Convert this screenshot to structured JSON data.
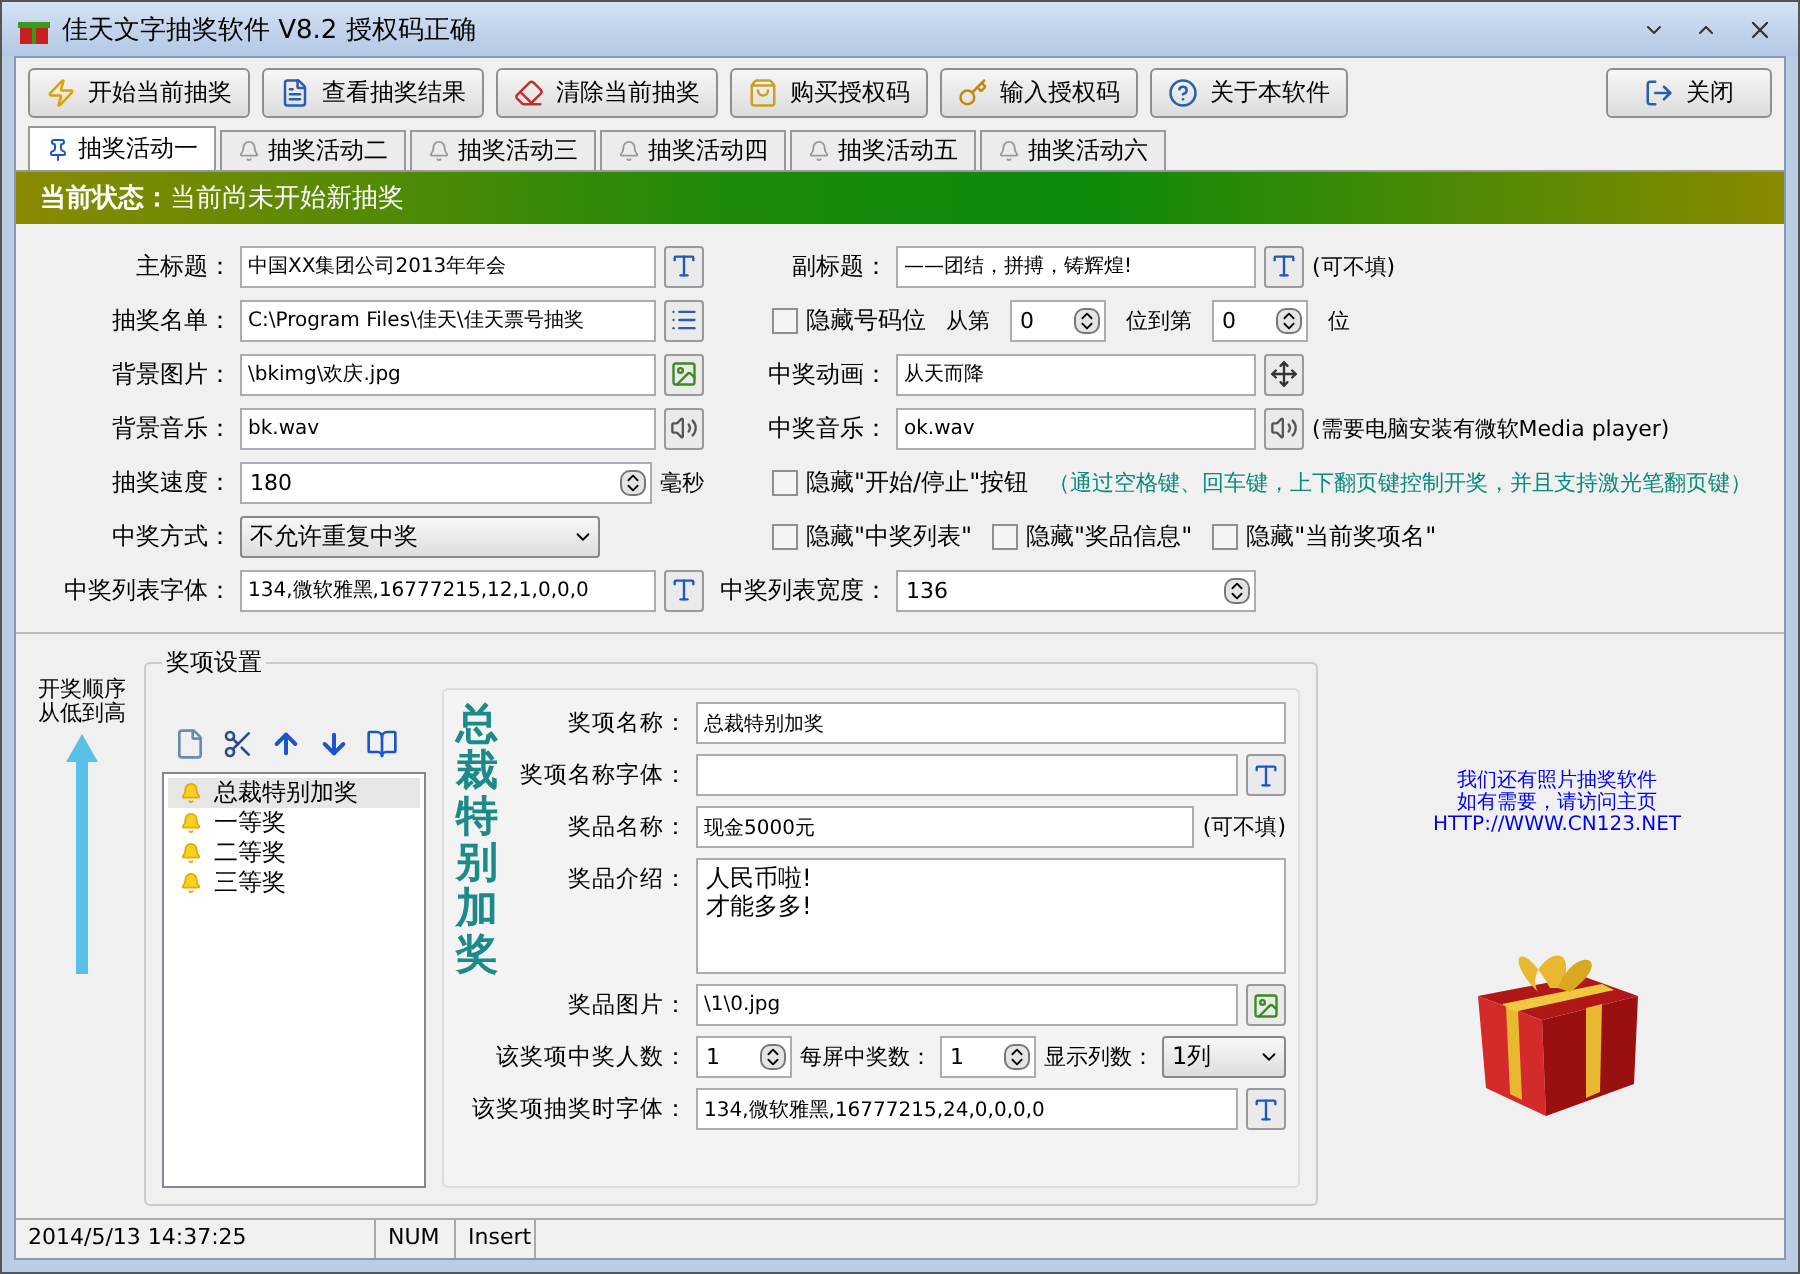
{
  "window": {
    "title": "佳天文字抽奖软件 V8.2 授权码正确"
  },
  "toolbar": {
    "left": [
      {
        "kind": "start",
        "label": "开始当前抽奖"
      },
      {
        "kind": "view",
        "label": "查看抽奖结果"
      },
      {
        "kind": "clear",
        "label": "清除当前抽奖"
      },
      {
        "kind": "buy",
        "label": "购买授权码"
      },
      {
        "kind": "enter",
        "label": "输入授权码"
      },
      {
        "kind": "about",
        "label": "关于本软件"
      }
    ],
    "right": [
      {
        "kind": "exit",
        "label": "关闭"
      }
    ]
  },
  "tabs": [
    {
      "label": "抽奖活动一",
      "selected": true
    },
    {
      "label": "抽奖活动二",
      "selected": false
    },
    {
      "label": "抽奖活动三",
      "selected": false
    },
    {
      "label": "抽奖活动四",
      "selected": false
    },
    {
      "label": "抽奖活动五",
      "selected": false
    },
    {
      "label": "抽奖活动六",
      "selected": false
    }
  ],
  "status_banner": {
    "label": "当前状态：",
    "value": "当前尚未开始新抽奖"
  },
  "settings": [
    {
      "left": {
        "label": "主标题：",
        "parts": [
          {
            "kind": "font-field",
            "value": "中国XX集团公司2013年年会"
          }
        ]
      },
      "right": {
        "label": "副标题：",
        "parts": [
          {
            "kind": "font-field",
            "value": "——团结，拼搏，铸辉煌!"
          },
          {
            "kind": "note",
            "text": "(可不填)"
          }
        ]
      }
    },
    {
      "left": {
        "label": "抽奖名单：",
        "parts": [
          {
            "kind": "list-field",
            "value": "C:\\Program Files\\佳天\\佳天票号抽奖"
          }
        ]
      },
      "right": {
        "parts": [
          {
            "kind": "check",
            "label": "隐藏号码位",
            "checked": false
          },
          {
            "kind": "note",
            "text": "从第"
          },
          {
            "kind": "spin-small",
            "value": "0"
          },
          {
            "kind": "note",
            "text": "位到第"
          },
          {
            "kind": "spin-small",
            "value": "0"
          },
          {
            "kind": "note",
            "text": "位"
          }
        ]
      }
    },
    {
      "left": {
        "label": "背景图片：",
        "parts": [
          {
            "kind": "image-field",
            "value": "\\bkimg\\欢庆.jpg"
          }
        ]
      },
      "right": {
        "label": "中奖动画：",
        "parts": [
          {
            "kind": "animation-field",
            "value": "从天而降"
          }
        ]
      }
    },
    {
      "left": {
        "label": "背景音乐：",
        "parts": [
          {
            "kind": "sound-field",
            "value": "bk.wav"
          }
        ]
      },
      "right": {
        "label": "中奖音乐：",
        "parts": [
          {
            "kind": "sound-field",
            "value": "ok.wav"
          },
          {
            "kind": "note",
            "text": "(需要电脑安装有微软Media player)"
          }
        ]
      }
    },
    {
      "left": {
        "label": "抽奖速度：",
        "parts": [
          {
            "kind": "spin",
            "value": "180"
          },
          {
            "kind": "note",
            "text": "毫秒"
          }
        ]
      },
      "right": {
        "parts": [
          {
            "kind": "check",
            "label": "隐藏\"开始/停止\"按钮",
            "checked": false
          },
          {
            "kind": "hint",
            "text": "（通过空格键、回车键，上下翻页键控制开奖，并且支持激光笔翻页键）"
          }
        ]
      }
    },
    {
      "left": {
        "label": "中奖方式：",
        "parts": [
          {
            "kind": "select",
            "value": "不允许重复中奖"
          }
        ]
      },
      "right": {
        "parts": [
          {
            "kind": "check",
            "label": "隐藏\"中奖列表\"",
            "checked": false
          },
          {
            "kind": "check",
            "label": "隐藏\"奖品信息\"",
            "checked": false
          },
          {
            "kind": "check",
            "label": "隐藏\"当前奖项名\"",
            "checked": false
          }
        ]
      }
    },
    {
      "left": {
        "label": "中奖列表字体：",
        "parts": [
          {
            "kind": "font-field",
            "value": "134,微软雅黑,16777215,12,1,0,0,0"
          }
        ]
      },
      "right": {
        "label": "中奖列表宽度：",
        "parts": [
          {
            "kind": "spin",
            "value": "136"
          }
        ]
      }
    }
  ],
  "order_note": {
    "lines": [
      "开奖顺序",
      "从低到高"
    ]
  },
  "prize_group": {
    "title": "奖项设置",
    "prizes": [
      {
        "label": "总裁特别加奖",
        "selected": true
      },
      {
        "label": "一等奖",
        "selected": false
      },
      {
        "label": "二等奖",
        "selected": false
      },
      {
        "label": "三等奖",
        "selected": false
      }
    ],
    "heading": "总裁特别加奖",
    "rows": [
      {
        "label": "奖项名称：",
        "parts": [
          {
            "kind": "field",
            "value": "总裁特别加奖"
          }
        ]
      },
      {
        "label": "奖项名称字体：",
        "parts": [
          {
            "kind": "font-field"
          }
        ]
      },
      {
        "label": "奖品名称：",
        "parts": [
          {
            "kind": "field",
            "value": "现金5000元"
          },
          {
            "kind": "note",
            "text": "(可不填)"
          }
        ]
      },
      {
        "label": "奖品介绍：",
        "parts": [
          {
            "kind": "textarea",
            "lines": [
              "人民币啦!",
              "才能多多!"
            ]
          }
        ]
      },
      {
        "label": "奖品图片：",
        "parts": [
          {
            "kind": "image-field",
            "value": "\\1\\0.jpg"
          }
        ]
      },
      {
        "label": "该奖项中奖人数：",
        "parts": [
          {
            "kind": "spin-small",
            "value": "1"
          },
          {
            "kind": "note",
            "text": "每屏中奖数："
          },
          {
            "kind": "spin-small",
            "value": "1"
          },
          {
            "kind": "note",
            "text": "显示列数："
          },
          {
            "kind": "select-small",
            "value": "1列"
          }
        ]
      },
      {
        "label": "该奖项抽奖时字体：",
        "parts": [
          {
            "kind": "font-field",
            "value": "134,微软雅黑,16777215,24,0,0,0,0"
          }
        ]
      }
    ]
  },
  "promo": {
    "lines": [
      "我们还有照片抽奖软件",
      "如有需要，请访问主页",
      "HTTP://WWW.CN123.NET"
    ]
  },
  "status_bar": {
    "datetime": "2014/5/13 14:37:25",
    "num": "NUM",
    "mode": "Insert"
  }
}
